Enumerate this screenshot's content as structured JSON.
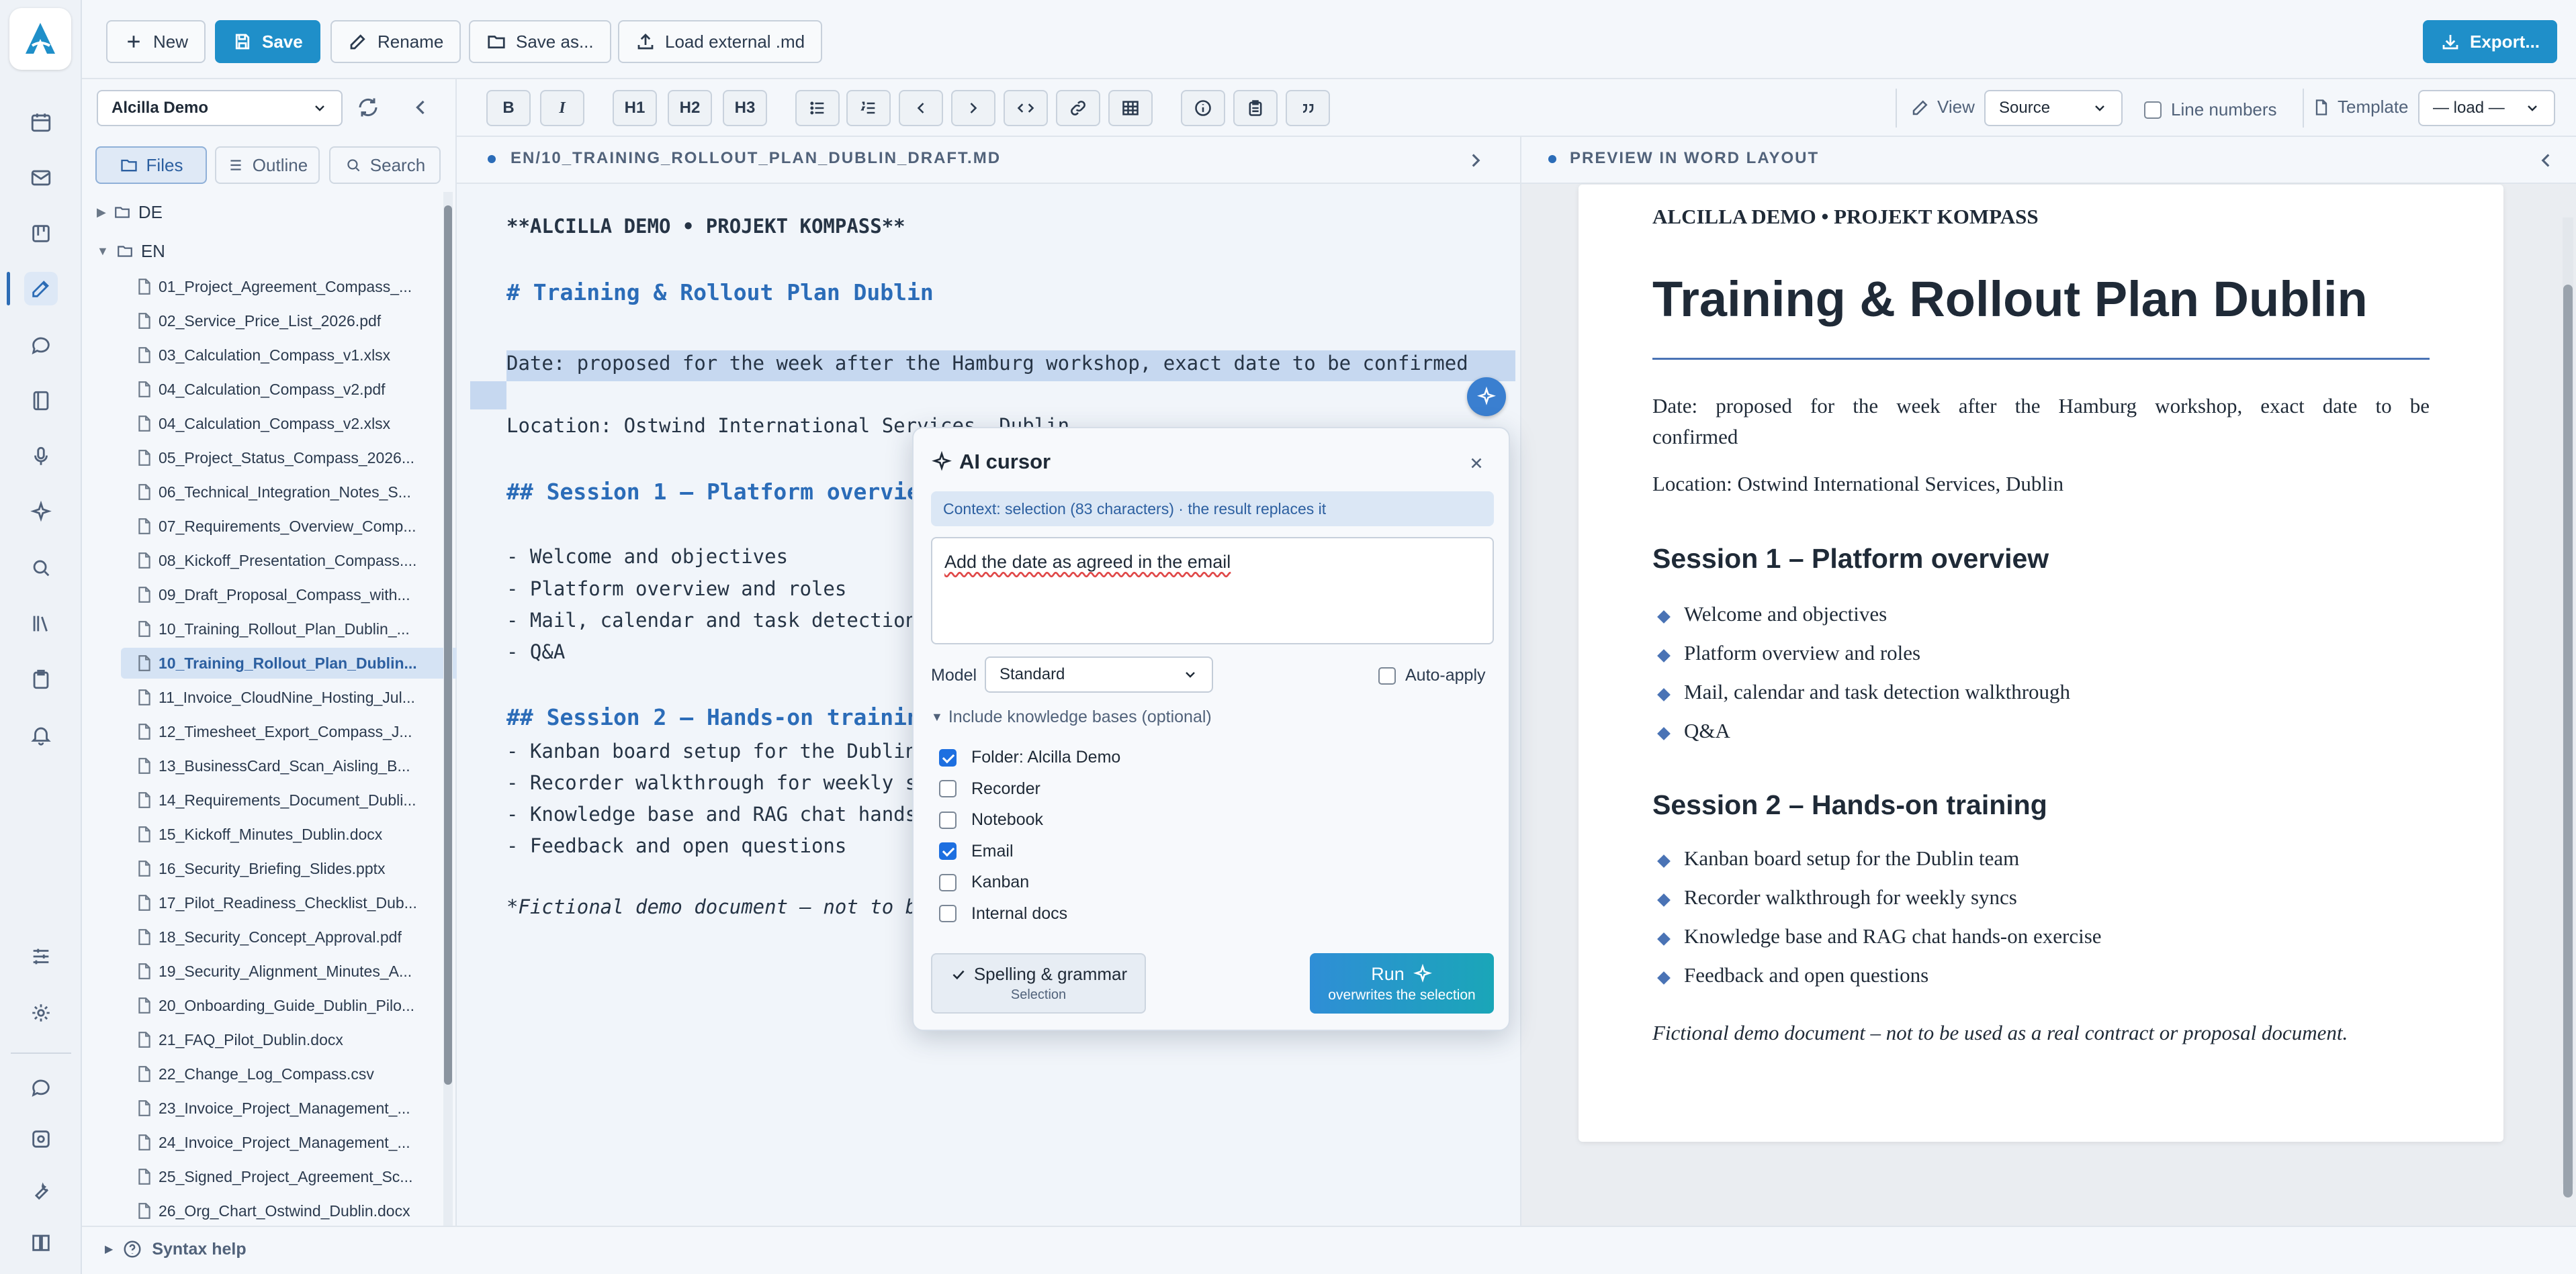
{
  "toolbar_top": {
    "new_label": "New",
    "save_label": "Save",
    "rename_label": "Rename",
    "save_as_label": "Save as...",
    "load_external_label": "Load external .md",
    "export_label": "Export..."
  },
  "format_toolbar": {
    "bold": "B",
    "italic": "I",
    "h1": "H1",
    "h2": "H2",
    "h3": "H3",
    "view_label": "View",
    "view_value": "Source",
    "line_numbers_label": "Line numbers",
    "template_label": "Template",
    "template_value": "— load —"
  },
  "sidebar": {
    "project_value": "Alcilla Demo",
    "tabs": [
      "Files",
      "Outline",
      "Search"
    ],
    "folders": [
      "DE",
      "EN"
    ],
    "files": [
      "01_Project_Agreement_Compass_...",
      "02_Service_Price_List_2026.pdf",
      "03_Calculation_Compass_v1.xlsx",
      "04_Calculation_Compass_v2.pdf",
      "04_Calculation_Compass_v2.xlsx",
      "05_Project_Status_Compass_2026...",
      "06_Technical_Integration_Notes_S...",
      "07_Requirements_Overview_Comp...",
      "08_Kickoff_Presentation_Compass....",
      "09_Draft_Proposal_Compass_with...",
      "10_Training_Rollout_Plan_Dublin_...",
      "10_Training_Rollout_Plan_Dublin...",
      "11_Invoice_CloudNine_Hosting_Jul...",
      "12_Timesheet_Export_Compass_J...",
      "13_BusinessCard_Scan_Aisling_B...",
      "14_Requirements_Document_Dubli...",
      "15_Kickoff_Minutes_Dublin.docx",
      "16_Security_Briefing_Slides.pptx",
      "17_Pilot_Readiness_Checklist_Dub...",
      "18_Security_Concept_Approval.pdf",
      "19_Security_Alignment_Minutes_A...",
      "20_Onboarding_Guide_Dublin_Pilo...",
      "21_FAQ_Pilot_Dublin.docx",
      "22_Change_Log_Compass.csv",
      "23_Invoice_Project_Management_...",
      "24_Invoice_Project_Management_...",
      "25_Signed_Project_Agreement_Sc...",
      "26_Org_Chart_Ostwind_Dublin.docx"
    ],
    "selected_index": 11
  },
  "editor": {
    "path": "EN/10_TRAINING_ROLLOUT_PLAN_DUBLIN_DRAFT.MD",
    "lines": {
      "l1": "**ALCILLA DEMO • PROJEKT KOMPASS**",
      "l2": "# Training & Rollout Plan Dublin",
      "l3": "Date: proposed for the week after the Hamburg workshop, exact date to be confirmed",
      "l4": "Location: Ostwind International Services, Dublin",
      "l5": "## Session 1 – Platform overview",
      "l6": "- Welcome and objectives",
      "l7": "- Platform overview and roles",
      "l8": "- Mail, calendar and task detection walkthrough",
      "l9": "- Q&A",
      "l10": "## Session 2 – Hands-on training",
      "l11": "- Kanban board setup for the Dublin team",
      "l12": "- Recorder walkthrough for weekly syncs",
      "l13": "- Knowledge base and RAG chat hands-on exercise",
      "l14": "- Feedback and open questions",
      "l15": "*Fictional demo document – not to be used as a real contract or proposal document.*"
    }
  },
  "ai_popup": {
    "title": "AI cursor",
    "context": "Context: selection (83 characters) · the result replaces it",
    "prompt_value": "Add the date as agreed in the email",
    "model_label": "Model",
    "model_value": "Standard",
    "auto_apply_label": "Auto-apply",
    "kb_toggle_label": "Include knowledge bases (optional)",
    "knowledge_bases": [
      {
        "label": "Folder: Alcilla Demo",
        "checked": true
      },
      {
        "label": "Recorder",
        "checked": false
      },
      {
        "label": "Notebook",
        "checked": false
      },
      {
        "label": "Email",
        "checked": true
      },
      {
        "label": "Kanban",
        "checked": false
      },
      {
        "label": "Internal docs",
        "checked": false
      }
    ],
    "spelling_label": "Spelling & grammar",
    "spelling_sub": "Selection",
    "run_label": "Run",
    "run_sub": "overwrites the selection"
  },
  "preview": {
    "header": "PREVIEW IN WORD LAYOUT",
    "kicker": "ALCILLA DEMO • PROJEKT KOMPASS",
    "title": "Training & Rollout Plan Dublin",
    "date_line1": "Date: proposed for the week after the Hamburg workshop, exact date to be",
    "date_line2": "confirmed",
    "location": "Location: Ostwind International Services, Dublin",
    "session1": "Session 1 – Platform overview",
    "session1_items": [
      "Welcome and objectives",
      "Platform overview and roles",
      "Mail, calendar and task detection walkthrough",
      "Q&A"
    ],
    "session2": "Session 2 – Hands-on training",
    "session2_items": [
      "Kanban board setup for the Dublin team",
      "Recorder walkthrough for weekly syncs",
      "Knowledge base and RAG chat hands-on exercise",
      "Feedback and open questions"
    ],
    "footnote": "Fictional demo document – not to be used as a real contract or proposal document."
  },
  "bottom": {
    "syntax_help": "Syntax help"
  },
  "colors": {
    "accent": "#1f8fc9",
    "heading_blue": "#2b6cb8",
    "selection": "#c6d8f0"
  }
}
